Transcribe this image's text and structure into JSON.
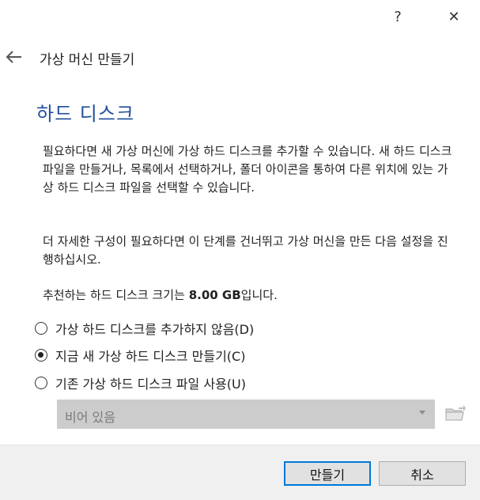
{
  "titlebar": {
    "help_glyph": "?",
    "close_glyph": "✕"
  },
  "header": {
    "title": "가상 머신 만들기",
    "back_icon": "back-arrow-icon"
  },
  "section": {
    "title": "하드 디스크"
  },
  "description": {
    "p1": "필요하다면 새 가상 머신에 가상 하드 디스크를 추가할 수 있습니다. 새 하드 디스크 파일을 만들거나, 목록에서 선택하거나, 폴더 아이콘을 통하여 다른 위치에 있는 가상 하드 디스크 파일을 선택할 수 있습니다.",
    "p2": "더 자세한 구성이 필요하다면 이 단계를 건너뛰고 가상 머신을 만든 다음 설정을 진행하십시오.",
    "p3_prefix": "추천하는 하드 디스크 크기는 ",
    "p3_size": "8.00 GB",
    "p3_suffix": "입니다."
  },
  "options": [
    {
      "label": "가상 하드 디스크를 추가하지 않음(D)",
      "checked": false
    },
    {
      "label": "지금 새 가상 하드 디스크 만들기(C)",
      "checked": true
    },
    {
      "label": "기존 가상 하드 디스크 파일 사용(U)",
      "checked": false
    }
  ],
  "disk_select": {
    "value": "비어 있음",
    "enabled": false
  },
  "footer": {
    "create_label": "만들기",
    "cancel_label": "취소"
  },
  "colors": {
    "accent": "#0078d7",
    "title_blue": "#1f4e9d",
    "footer_bg": "#f0f0f0"
  }
}
